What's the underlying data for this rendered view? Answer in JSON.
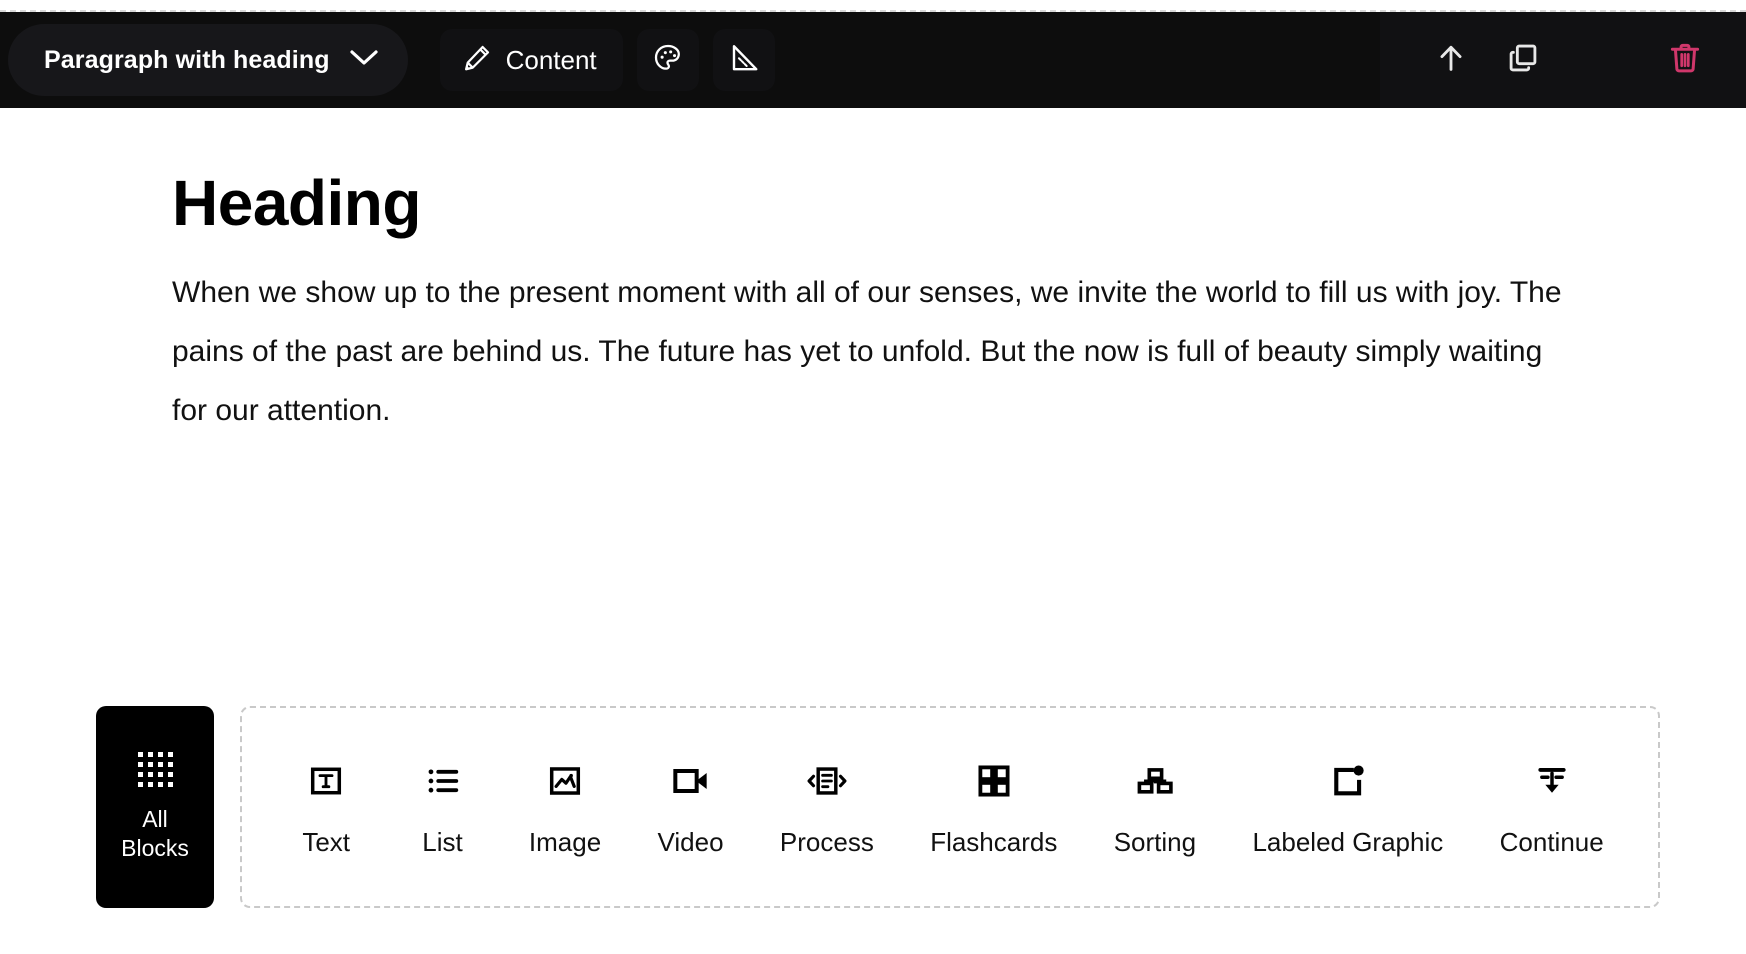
{
  "toolbar": {
    "block_type": {
      "label": "Paragraph with heading",
      "chevron_icon": "chevron-down-icon"
    },
    "content_button": {
      "label": "Content",
      "icon": "pencil-icon"
    },
    "design_button": {
      "icon": "palette-icon"
    },
    "layout_button": {
      "icon": "ruler-triangle-icon"
    },
    "move_up_button": {
      "icon": "arrow-up-icon"
    },
    "duplicate_button": {
      "icon": "copy-icon"
    },
    "delete_button": {
      "icon": "trash-icon"
    },
    "colors": {
      "bar_background": "#0d0d0d",
      "pill_background": "#17171a",
      "button_background": "#111113",
      "text": "#ffffff",
      "delete_accent": "#d0376b"
    }
  },
  "content": {
    "heading": "Heading",
    "paragraph": "When we show up to the present moment with all of our senses, we invite the world to fill us with joy. The pains of the past are behind us. The future has yet to unfold. But the now is full of beauty simply waiting for our attention."
  },
  "picker": {
    "all_blocks": {
      "label_line1": "All",
      "label_line2": "Blocks",
      "icon": "grid-dots-icon"
    },
    "blocks": [
      {
        "label": "Text",
        "icon": "text-box-icon"
      },
      {
        "label": "List",
        "icon": "bullet-list-icon"
      },
      {
        "label": "Image",
        "icon": "image-icon"
      },
      {
        "label": "Video",
        "icon": "video-camera-icon"
      },
      {
        "label": "Process",
        "icon": "process-carousel-icon"
      },
      {
        "label": "Flashcards",
        "icon": "four-squares-icon"
      },
      {
        "label": "Sorting",
        "icon": "hierarchy-boxes-icon"
      },
      {
        "label": "Labeled Graphic",
        "icon": "labeled-graphic-icon"
      },
      {
        "label": "Continue",
        "icon": "continue-arrow-down-icon"
      }
    ],
    "border_color": "#c9c9c9"
  }
}
